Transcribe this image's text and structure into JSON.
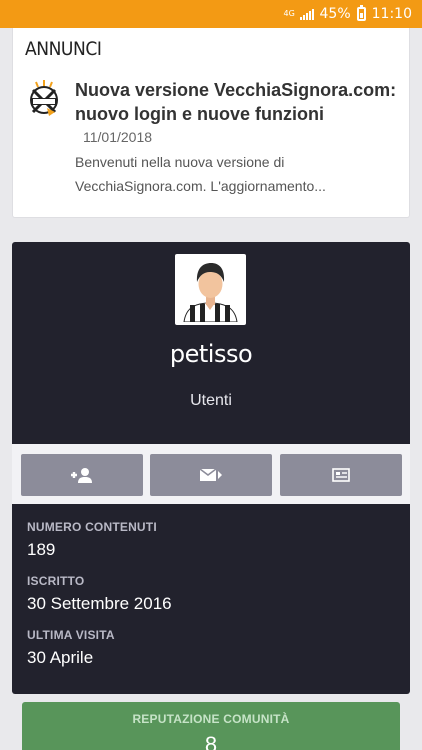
{
  "status_bar": {
    "network": "4G",
    "battery": "45%",
    "time": "11:10"
  },
  "announcements": {
    "heading": "ANNUNCI",
    "item": {
      "logo_icon": "vecchiasignora-logo-icon",
      "title": "Nuova versione VecchiaSignora.com: nuovo login e nuove funzioni",
      "date": "11/01/2018",
      "excerpt": "Benvenuti nella nuova versione di VecchiaSignora.com. L'aggiornamento..."
    }
  },
  "profile": {
    "avatar_icon": "user-avatar-icon",
    "username": "petisso",
    "group": "Utenti",
    "actions": [
      {
        "icon": "add-friend-icon"
      },
      {
        "icon": "send-message-icon"
      },
      {
        "icon": "id-card-icon"
      }
    ],
    "stats": [
      {
        "label": "NUMERO CONTENUTI",
        "value": "189"
      },
      {
        "label": "ISCRITTO",
        "value": "30 Settembre 2016"
      },
      {
        "label": "ULTIMA VISITA",
        "value": "30 Aprile"
      }
    ]
  },
  "reputation": {
    "label": "REPUTAZIONE COMUNITÀ",
    "value": "8"
  },
  "colors": {
    "status_bar": "#f39a14",
    "profile_bg": "#22222d",
    "action_button": "#8c8c9a",
    "reputation_bg": "#58955a"
  }
}
